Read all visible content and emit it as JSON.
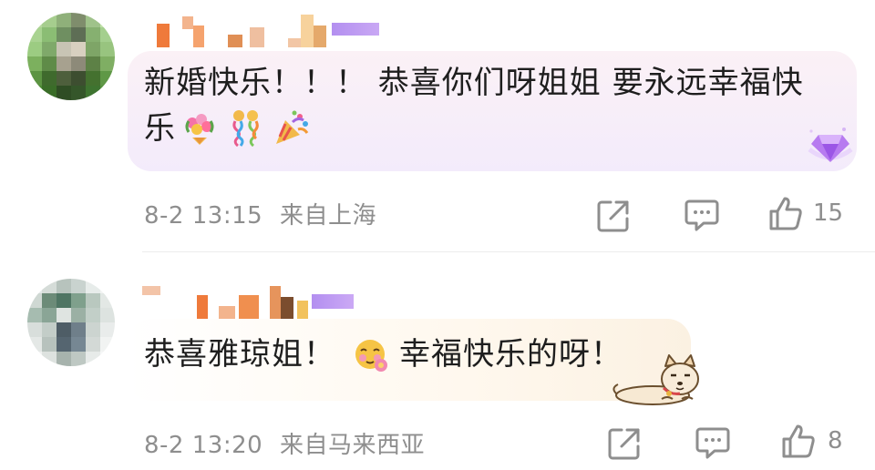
{
  "comments": [
    {
      "text_line1": "新婚快乐！！！ 恭喜你们呀姐姐 要永远幸福快",
      "text_line2": "乐",
      "emojis": [
        "bouquet-emoji",
        "confetti-emoji",
        "party-popper-emoji"
      ],
      "timestamp": "8-2 13:15",
      "location": "来自上海",
      "like_count": "15",
      "badge": "diamond-badge",
      "colors": {
        "bubble_start": "#fbf3f8",
        "bubble_end": "#efe6fb"
      }
    },
    {
      "text_before_emoji": "恭喜雅琼姐！",
      "emoji": "blushing-face-emoji",
      "text_after_emoji": "幸福快乐的呀！",
      "timestamp": "8-2 13:20",
      "location": "来自马来西亚",
      "like_count": "8",
      "sticker": "shiba-dog-sticker",
      "colors": {
        "bubble_start": "#ffffff",
        "bubble_end": "#fdf5e6"
      }
    }
  ],
  "icons": {
    "share": "share-icon",
    "reply": "comment-icon",
    "like": "thumbs-up-icon"
  }
}
